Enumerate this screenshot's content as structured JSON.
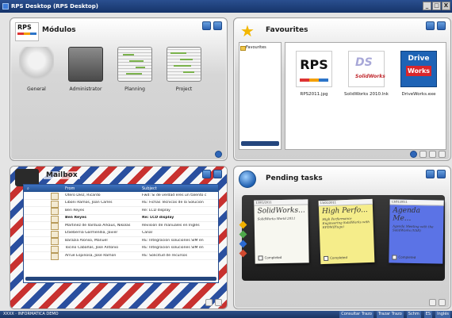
{
  "window": {
    "title": "RPS Desktop (RPS Desktop)",
    "controls": [
      "_",
      "□",
      "X"
    ]
  },
  "modulos": {
    "title": "Módulos",
    "logo_text": "RPS",
    "items": [
      {
        "label": "General",
        "icon": "gears-icon"
      },
      {
        "label": "Administrator",
        "icon": "safe-icon"
      },
      {
        "label": "Planning",
        "icon": "gantt-icon"
      },
      {
        "label": "Project",
        "icon": "gantt-icon"
      }
    ]
  },
  "favourites": {
    "title": "Favourites",
    "tree": [
      "Favourites"
    ],
    "files": [
      {
        "label": "RPS2011.jpg",
        "icon": "rps-logo-icon",
        "logo": "RPS"
      },
      {
        "label": "SolidWorks 2010.lnk",
        "icon": "solidworks-icon",
        "logo_top": "DS",
        "logo_bottom": "SolidWorks"
      },
      {
        "label": "DriveWorks.exe",
        "icon": "driveworks-icon",
        "logo_top": "Drive",
        "logo_bottom": "Works"
      }
    ]
  },
  "mailbox": {
    "title": "Mailbox",
    "columns": {
      "from": "From",
      "subject": "Subject"
    },
    "rows": [
      {
        "from": "Otero Díez, Ricardo",
        "subject": "Fwd: Si de verdad eres un talento c",
        "bold": false
      },
      {
        "from": "Liboni Ramos, Joan Carles",
        "subject": "RE: Fichas Técnicas de la Solución",
        "bold": false
      },
      {
        "from": "Ben Reyes",
        "subject": "Re: LCD display",
        "bold": false
      },
      {
        "from": "Ben Reyes",
        "subject": "Re: LCD display",
        "bold": true
      },
      {
        "from": "Martinez de Ilarduia Arkaus, Nikolas",
        "subject": "Revisión de manuales en Inglés",
        "bold": false
      },
      {
        "from": "Etxeberria Garmendia, Javier",
        "subject": "Canal",
        "bold": false
      },
      {
        "from": "Barazia Alonso, Manuel",
        "subject": "RE: Integración soluciones SIM en",
        "bold": false
      },
      {
        "from": "Tocino Cabañas, Jose Antonio",
        "subject": "RE: Integración soluciones SIM en",
        "bold": false
      },
      {
        "from": "Arrue Espinosa, Jose Ramon",
        "subject": "RE: Solicitud de recursos",
        "bold": false
      }
    ]
  },
  "tasks": {
    "title": "Pending tasks",
    "notes": [
      {
        "date": "13/01/2011",
        "title": "SolidWorks...",
        "subtitle": "SolidWorks World 2011",
        "status": "Completed",
        "color": "#f7f7f0"
      },
      {
        "date": "13/01/2011",
        "title": "High Perfo...",
        "subtitle": "High Performance Engineering SolidWorks with EPDM(Hugo)",
        "status": "Completed",
        "color": "#f5ed8a"
      },
      {
        "date": "13/01/2011",
        "title": "Agenda Me...",
        "subtitle": "Agenda Meeting with the SolidWorks (VAR)",
        "status": "Completed",
        "color": "#5b73e6"
      }
    ],
    "pin_colors": [
      "#f0b000",
      "#4ea84a",
      "#2b6ad1",
      "#d04a30"
    ]
  },
  "taskbar": {
    "left": "XXXX · INFORMATICA DEMO",
    "right": [
      "Consultar Trazo",
      "Trazar Trazo",
      "Schm",
      "ES",
      "Inglés"
    ]
  }
}
